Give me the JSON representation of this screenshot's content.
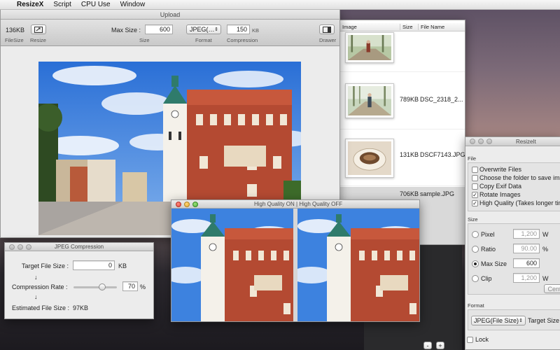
{
  "menubar": {
    "app_name": "ResizeX",
    "items": [
      "Script",
      "CPU Use",
      "Window"
    ]
  },
  "upload": {
    "title": "Upload",
    "filesize_value": "136KB",
    "filesize_label": "FileSize",
    "resize_label": "Resize",
    "max_size_label": "Max Size :",
    "max_size_value": "600",
    "size_caption": "Size",
    "format_value": "JPEG(…",
    "format_caption": "Format",
    "compression_value": "150",
    "compression_unit": "KB",
    "compression_caption": "Compression",
    "drawer_label": "Drawer"
  },
  "filelist": {
    "headers": {
      "image": "Image",
      "size": "Size",
      "name": "File Name"
    },
    "rows": [
      {
        "size": "",
        "name": ""
      },
      {
        "size": "789KB",
        "name": "DSC_2318_2..."
      },
      {
        "size": "131KB",
        "name": "DSCF7143.JPG"
      },
      {
        "size": "706KB",
        "name": "sample.JPG"
      }
    ],
    "remove_label": "-",
    "add_label": "+"
  },
  "jpeg": {
    "title": "JPEG Compression",
    "target_label": "Target File Size :",
    "target_value": "0",
    "target_unit": "KB",
    "arrow": "↓",
    "rate_label": "Compression Rate :",
    "rate_value": "70",
    "rate_unit": "%",
    "rate_fraction": 0.7,
    "estimated_label": "Estimated File Size :",
    "estimated_value": "97KB"
  },
  "quality": {
    "title": "High Quality ON | High Quality OFF"
  },
  "resizeit": {
    "title": "ResizeIt",
    "file_section": "File",
    "options": [
      {
        "label": "Overwrite Files",
        "checked": false
      },
      {
        "label": "Choose the folder to save ima",
        "checked": false
      },
      {
        "label": "Copy Exif Data",
        "checked": false
      },
      {
        "label": "Rotate Images",
        "checked": true
      },
      {
        "label": "High Quality (Takes longer tim",
        "checked": true
      }
    ],
    "size_section": "Size",
    "pixel_label": "Pixel",
    "pixel_value": "1,200",
    "ratio_label": "Ratio",
    "ratio_value": "90.00",
    "ratio_unit": "%",
    "maxsize_label": "Max Size",
    "maxsize_value": "600",
    "clip_label": "Clip",
    "clip_value": "1,200",
    "w_label": "W",
    "center_label": "Cent",
    "format_section": "Format",
    "format_value": "JPEG(File Size)",
    "target_size_label": "Target Size :",
    "lock_label": "Lock"
  },
  "icons": {
    "apple": "",
    "arrow": "↓",
    "check": "✓"
  }
}
